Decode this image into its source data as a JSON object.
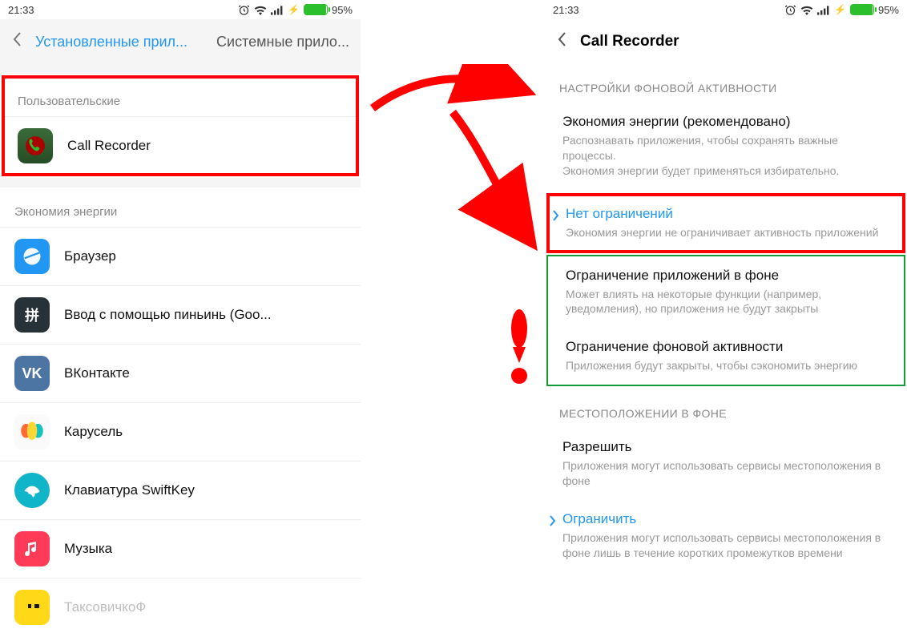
{
  "status": {
    "time": "21:33",
    "battery": "95%"
  },
  "left": {
    "tabActive": "Установленные прил...",
    "tabInactive": "Системные прило...",
    "sectionUser": "Пользовательские",
    "appCallRecorder": "Call Recorder",
    "sectionEnergy": "Экономия энергии",
    "apps": {
      "browser": "Браузер",
      "pinyin": "Ввод с помощью пиньинь (Goo...",
      "vk": "ВКонтакте",
      "carousel": "Карусель",
      "swiftkey": "Клавиатура SwiftKey",
      "music": "Музыка",
      "taxi": "ТаксовичкоФ"
    }
  },
  "right": {
    "title": "Call Recorder",
    "sectionBg": "НАСТРОЙКИ ФОНОВОЙ АКТИВНОСТИ",
    "opt1t": "Экономия энергии (рекомендовано)",
    "opt1d": "Распознавать приложения, чтобы сохранять важные процессы.\nЭкономия энергии будет применяться избирательно.",
    "opt2t": "Нет ограничений",
    "opt2d": "Экономия энергии не ограничивает активность приложений",
    "opt3t": "Ограничение приложений в фоне",
    "opt3d": "Может влиять на некоторые функции (например, уведомления), но приложения не будут закрыты",
    "opt4t": "Ограничение фоновой активности",
    "opt4d": "Приложения будут закрыты, чтобы сэкономить энергию",
    "sectionLoc": "МЕСТОПОЛОЖЕНИИ В ФОНЕ",
    "loc1t": "Разрешить",
    "loc1d": "Приложения могут использовать сервисы местоположения в фоне",
    "loc2t": "Ограничить",
    "loc2d": "Приложения могут использовать сервисы местоположения в фоне лишь в течение коротких промежутков времени"
  }
}
